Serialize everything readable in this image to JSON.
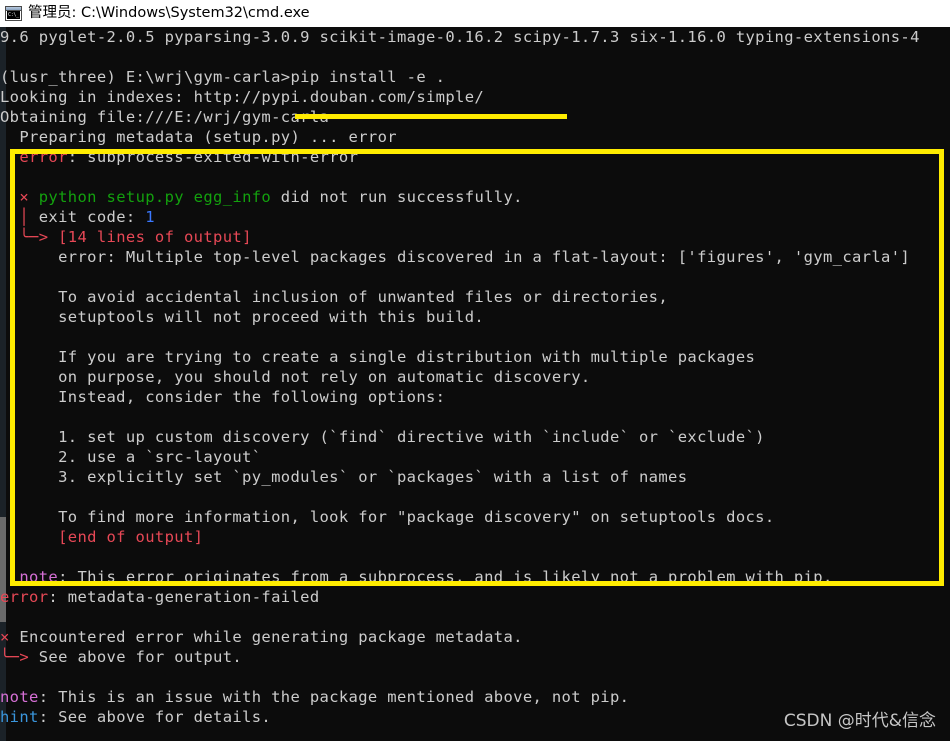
{
  "window": {
    "title": "管理员: C:\\Windows\\System32\\cmd.exe",
    "icon_name": "cmd-window-icon",
    "icon_glyph": "C:\\_"
  },
  "colors": {
    "background": "#0c0c0c",
    "foreground": "#cccccc",
    "titlebar_bg": "#ffffff",
    "annotation_yellow": "#ffec00",
    "red": "#e74856",
    "green": "#13a10e",
    "cyan": "#3a96dd",
    "blue": "#3b78ff",
    "magenta": "#d670d6"
  },
  "annotations": {
    "underline_label": "yellow-underline-on-pip-command",
    "box_label": "yellow-highlight-box-around-error-output"
  },
  "watermark": {
    "text": "CSDN @时代&信念"
  },
  "terminal": {
    "lines": [
      {
        "id": "scrollback-packages",
        "segments": [
          {
            "text": "9.6 pyglet-2.0.5 pyparsing-3.0.9 scikit-image-0.16.2 scipy-1.7.3 six-1.16.0 typing-extensions-4",
            "color": "white"
          }
        ]
      },
      {
        "id": "blank-1",
        "segments": [
          {
            "text": "",
            "color": "white"
          }
        ]
      },
      {
        "id": "prompt-pip-install",
        "segments": [
          {
            "text": "(lusr_three) E:\\wrj\\gym-carla>pip install -e .",
            "color": "white"
          }
        ]
      },
      {
        "id": "looking-in-indexes",
        "segments": [
          {
            "text": "Looking in indexes: http://pypi.douban.com/simple/",
            "color": "white"
          }
        ]
      },
      {
        "id": "obtaining-file",
        "segments": [
          {
            "text": "Obtaining file:///E:/wrj/gym-carla",
            "color": "white"
          }
        ]
      },
      {
        "id": "preparing-metadata",
        "segments": [
          {
            "text": "  Preparing metadata (setup.py) ... error",
            "color": "white"
          }
        ]
      },
      {
        "id": "error-subprocess-exited",
        "segments": [
          {
            "text": "  ",
            "color": "white"
          },
          {
            "text": "error",
            "color": "red"
          },
          {
            "text": ": subprocess-exited-with-error",
            "color": "white"
          }
        ]
      },
      {
        "id": "blank-2",
        "segments": [
          {
            "text": "",
            "color": "white"
          }
        ]
      },
      {
        "id": "egg-info-failed",
        "segments": [
          {
            "text": "  ",
            "color": "white"
          },
          {
            "text": "×",
            "color": "red"
          },
          {
            "text": " ",
            "color": "white"
          },
          {
            "text": "python setup.py egg_info",
            "color": "green"
          },
          {
            "text": " did not run successfully.",
            "color": "white"
          }
        ]
      },
      {
        "id": "exit-code",
        "segments": [
          {
            "text": "  ",
            "color": "white"
          },
          {
            "text": "│",
            "color": "red"
          },
          {
            "text": " exit code: ",
            "color": "white"
          },
          {
            "text": "1",
            "color": "blue"
          }
        ]
      },
      {
        "id": "lines-of-output",
        "segments": [
          {
            "text": "  ",
            "color": "white"
          },
          {
            "text": "╰─> ",
            "color": "red"
          },
          {
            "text": "[14 lines of output]",
            "color": "red"
          }
        ]
      },
      {
        "id": "multiple-top-level-packages",
        "segments": [
          {
            "text": "      error: Multiple top-level packages discovered in a flat-layout: ['figures', 'gym_carla']",
            "color": "white"
          }
        ]
      },
      {
        "id": "blank-3",
        "segments": [
          {
            "text": "",
            "color": "white"
          }
        ]
      },
      {
        "id": "to-avoid-accidental",
        "segments": [
          {
            "text": "      To avoid accidental inclusion of unwanted files or directories,",
            "color": "white"
          }
        ]
      },
      {
        "id": "setuptools-will-not-proceed",
        "segments": [
          {
            "text": "      setuptools will not proceed with this build.",
            "color": "white"
          }
        ]
      },
      {
        "id": "blank-4",
        "segments": [
          {
            "text": "",
            "color": "white"
          }
        ]
      },
      {
        "id": "if-you-are-trying",
        "segments": [
          {
            "text": "      If you are trying to create a single distribution with multiple packages",
            "color": "white"
          }
        ]
      },
      {
        "id": "on-purpose",
        "segments": [
          {
            "text": "      on purpose, you should not rely on automatic discovery.",
            "color": "white"
          }
        ]
      },
      {
        "id": "instead-consider",
        "segments": [
          {
            "text": "      Instead, consider the following options:",
            "color": "white"
          }
        ]
      },
      {
        "id": "blank-5",
        "segments": [
          {
            "text": "",
            "color": "white"
          }
        ]
      },
      {
        "id": "option-1",
        "segments": [
          {
            "text": "      1. set up custom discovery (`find` directive with `include` or `exclude`)",
            "color": "white"
          }
        ]
      },
      {
        "id": "option-2",
        "segments": [
          {
            "text": "      2. use a `src-layout`",
            "color": "white"
          }
        ]
      },
      {
        "id": "option-3",
        "segments": [
          {
            "text": "      3. explicitly set `py_modules` or `packages` with a list of names",
            "color": "white"
          }
        ]
      },
      {
        "id": "blank-6",
        "segments": [
          {
            "text": "",
            "color": "white"
          }
        ]
      },
      {
        "id": "to-find-more-information",
        "segments": [
          {
            "text": "      To find more information, look for \"package discovery\" on setuptools docs.",
            "color": "white"
          }
        ]
      },
      {
        "id": "end-of-output",
        "segments": [
          {
            "text": "      ",
            "color": "white"
          },
          {
            "text": "[end of output]",
            "color": "red"
          }
        ]
      },
      {
        "id": "blank-7",
        "segments": [
          {
            "text": "",
            "color": "white"
          }
        ]
      },
      {
        "id": "note-originates-subprocess",
        "segments": [
          {
            "text": "  ",
            "color": "white"
          },
          {
            "text": "note",
            "color": "magenta"
          },
          {
            "text": ": This error originates from a subprocess, and is likely not a problem with pip.",
            "color": "white"
          }
        ]
      },
      {
        "id": "error-metadata-generation-failed",
        "segments": [
          {
            "text": "error",
            "color": "red"
          },
          {
            "text": ": metadata-generation-failed",
            "color": "white"
          }
        ]
      },
      {
        "id": "blank-8",
        "segments": [
          {
            "text": "",
            "color": "white"
          }
        ]
      },
      {
        "id": "encountered-error",
        "segments": [
          {
            "text": "×",
            "color": "red"
          },
          {
            "text": " Encountered error while generating package metadata.",
            "color": "white"
          }
        ]
      },
      {
        "id": "see-above-for-output",
        "segments": [
          {
            "text": "╰─> ",
            "color": "red"
          },
          {
            "text": "See above for output.",
            "color": "white"
          }
        ]
      },
      {
        "id": "blank-9",
        "segments": [
          {
            "text": "",
            "color": "white"
          }
        ]
      },
      {
        "id": "note-issue-with-package",
        "segments": [
          {
            "text": "note",
            "color": "magenta"
          },
          {
            "text": ": This is an issue with the package mentioned above, not pip.",
            "color": "white"
          }
        ]
      },
      {
        "id": "hint-see-above",
        "segments": [
          {
            "text": "hint",
            "color": "cyan"
          },
          {
            "text": ": See above for details.",
            "color": "white"
          }
        ]
      }
    ]
  }
}
